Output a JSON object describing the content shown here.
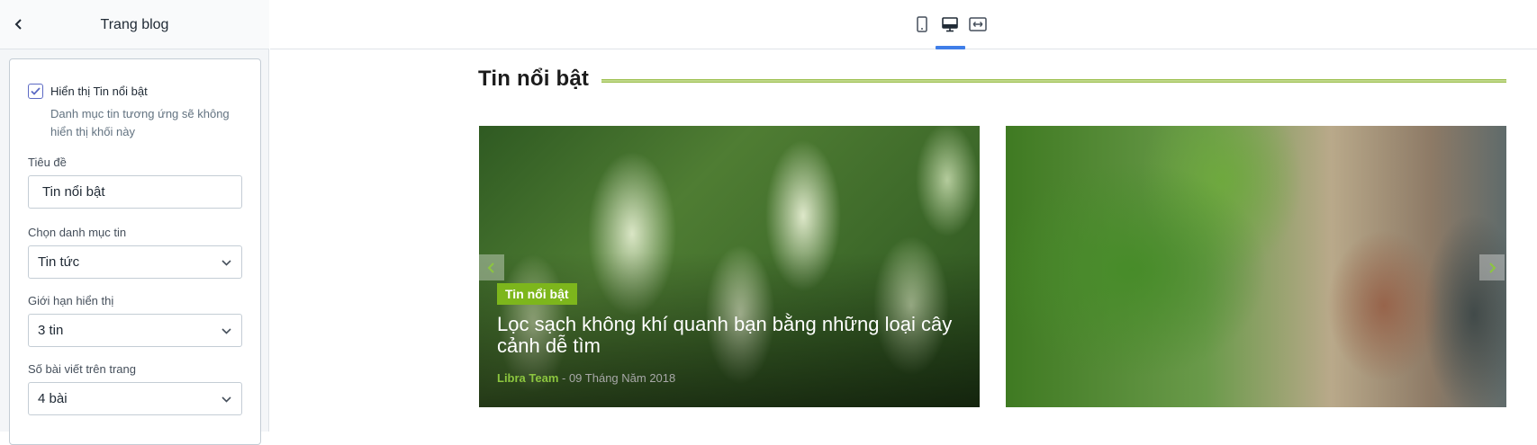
{
  "sidebar": {
    "title": "Trang blog",
    "show_featured": {
      "label": "Hiển thị Tin nổi bật",
      "checked": true,
      "help": "Danh mục tin tương ứng sẽ không hiển thị khối này"
    },
    "title_field": {
      "label": "Tiêu đề",
      "value": "Tin nổi bật"
    },
    "category_field": {
      "label": "Chọn danh mục tin",
      "value": "Tin tức"
    },
    "limit_field": {
      "label": "Giới hạn hiển thị",
      "value": "3 tin"
    },
    "per_page_field": {
      "label": "Số bài viết trên trang",
      "value": "4 bài"
    }
  },
  "toolbar": {
    "devices": [
      {
        "name": "mobile",
        "icon": "mobile-icon",
        "active": false
      },
      {
        "name": "desktop",
        "icon": "desktop-icon",
        "active": true
      },
      {
        "name": "fullwidth",
        "icon": "fullwidth-icon",
        "active": false
      }
    ]
  },
  "preview": {
    "section_title": "Tin nổi bật",
    "cards": [
      {
        "tag": "Tin nổi bật",
        "title": "Lọc sạch không khí quanh bạn bằng những loại cây cảnh dễ tìm",
        "author": "Libra Team",
        "date": "- 09 Tháng Năm 2018",
        "image": "dieffenbachia-leaves"
      },
      {
        "image": "boxwood-plant"
      }
    ]
  },
  "colors": {
    "accent_green": "#7db61c",
    "tab_active": "#3f7ee8",
    "checkbox": "#5c6ac4"
  }
}
